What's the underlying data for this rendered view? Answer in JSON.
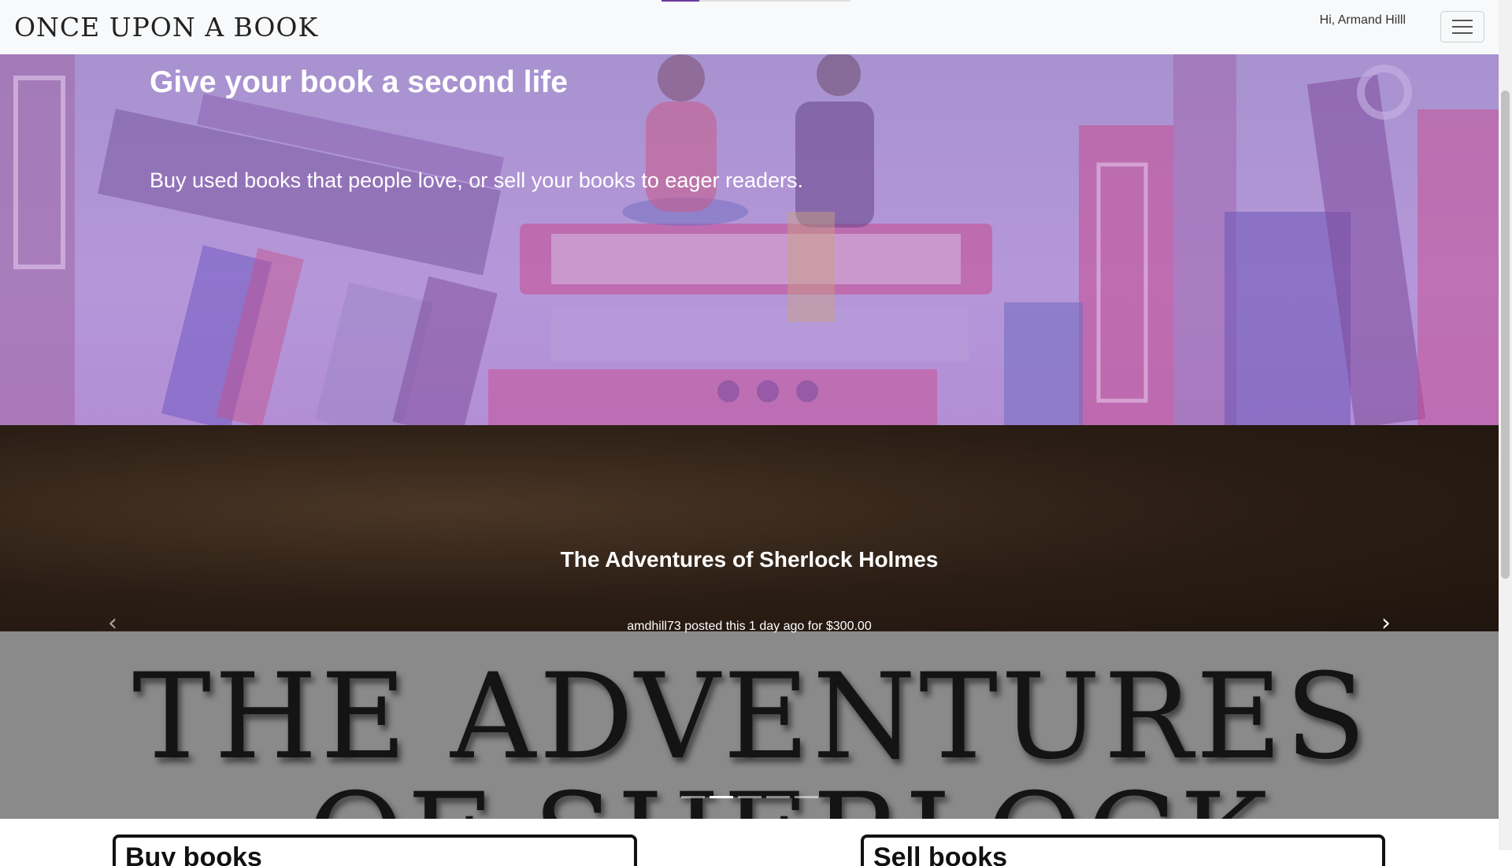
{
  "nav": {
    "brand": "ONCE UPON A BOOK",
    "greeting": "Hi, Armand Hilll",
    "menu_icon": "hamburger-icon"
  },
  "hero": {
    "title": "Give your book a second life",
    "subtitle": "Buy used books that people love, or sell your books to eager readers."
  },
  "carousel": {
    "cover_line_1": "THE ADVENTURES",
    "cover_line_2": "OF SHERLOCK",
    "title": "The Adventures of Sherlock Holmes",
    "meta": "amdhill73 posted this 1 day ago for $300.00",
    "prev_icon": "chevron-left-icon",
    "next_icon": "chevron-right-icon",
    "prev_glyph": "‹",
    "next_glyph": "›",
    "slide_count": 5,
    "active_slide": 2
  },
  "cards": {
    "buy_label": "Buy books",
    "sell_label": "Sell books"
  },
  "colors": {
    "hero_tint": "#b597d9",
    "accent": "#6a3aa0",
    "navbar_bg": "#f8f9fa"
  }
}
